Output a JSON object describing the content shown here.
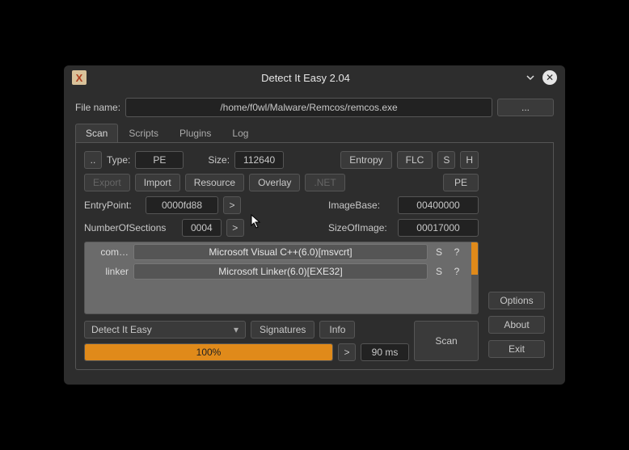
{
  "window": {
    "title": "Detect It Easy 2.04"
  },
  "file": {
    "label": "File name:",
    "path": "/home/f0wl/Malware/Remcos/remcos.exe",
    "browse": "..."
  },
  "tabs": [
    "Scan",
    "Scripts",
    "Plugins",
    "Log"
  ],
  "toolbar1": {
    "dotdot": "..",
    "type_label": "Type:",
    "type_value": "PE",
    "size_label": "Size:",
    "size_value": "112640",
    "entropy": "Entropy",
    "flc": "FLC",
    "s": "S",
    "h": "H"
  },
  "toolbar2": {
    "export": "Export",
    "import": "Import",
    "resource": "Resource",
    "overlay": "Overlay",
    "net": ".NET",
    "pe": "PE"
  },
  "fields": {
    "entrypoint_label": "EntryPoint:",
    "entrypoint_value": "0000fd88",
    "imagebase_label": "ImageBase:",
    "imagebase_value": "00400000",
    "numsections_label": "NumberOfSections",
    "numsections_value": "0004",
    "sizeofimage_label": "SizeOfImage:",
    "sizeofimage_value": "00017000",
    "go": ">"
  },
  "results": [
    {
      "type": "com…",
      "value": "Microsoft Visual C++(6.0)[msvcrt]",
      "s": "S",
      "q": "?"
    },
    {
      "type": "linker",
      "value": "Microsoft Linker(6.0)[EXE32]",
      "s": "S",
      "q": "?"
    }
  ],
  "bottom": {
    "mode": "Detect It Easy",
    "signatures": "Signatures",
    "info": "Info",
    "scan": "Scan",
    "progress": "100%",
    "go": ">",
    "time": "90 ms"
  },
  "side": {
    "options": "Options",
    "about": "About",
    "exit": "Exit"
  }
}
